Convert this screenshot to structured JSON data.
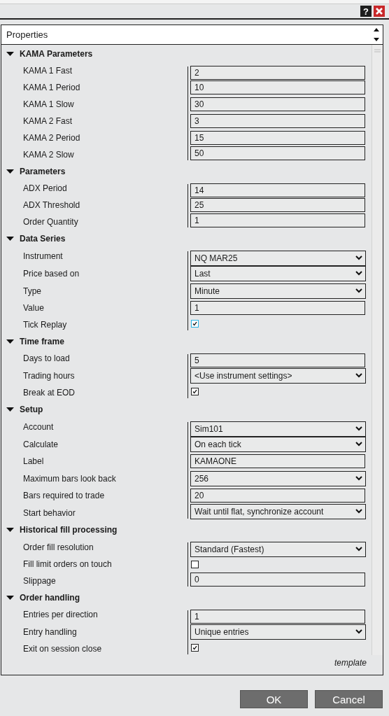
{
  "title_bar": {
    "help_label": "?"
  },
  "properties_header": {
    "title": "Properties"
  },
  "sections": [
    {
      "name": "KAMA Parameters",
      "expanded": true,
      "rows": [
        {
          "label": "KAMA 1 Fast",
          "kind": "text",
          "value": "2"
        },
        {
          "label": "KAMA 1 Period",
          "kind": "text",
          "value": "10"
        },
        {
          "label": "KAMA 1 Slow",
          "kind": "text",
          "value": "30"
        },
        {
          "label": "KAMA 2 Fast",
          "kind": "text",
          "value": "3"
        },
        {
          "label": "KAMA 2 Period",
          "kind": "text",
          "value": "15"
        },
        {
          "label": "KAMA 2 Slow",
          "kind": "text",
          "value": "50"
        }
      ]
    },
    {
      "name": "Parameters",
      "expanded": true,
      "rows": [
        {
          "label": "ADX Period",
          "kind": "text",
          "value": "14"
        },
        {
          "label": "ADX Threshold",
          "kind": "text",
          "value": "25"
        },
        {
          "label": "Order Quantity",
          "kind": "text",
          "value": "1"
        }
      ]
    },
    {
      "name": "Data Series",
      "expanded": true,
      "rows": [
        {
          "label": "Instrument",
          "kind": "dropdown",
          "value": "NQ MAR25"
        },
        {
          "label": "Price based on",
          "kind": "dropdown",
          "value": "Last"
        },
        {
          "label": "Type",
          "kind": "dropdown",
          "value": "Minute"
        },
        {
          "label": "Value",
          "kind": "text",
          "value": "1"
        },
        {
          "label": "Tick Replay",
          "kind": "checkbox",
          "checked": true,
          "focused": true
        }
      ]
    },
    {
      "name": "Time frame",
      "expanded": true,
      "rows": [
        {
          "label": "Days to load",
          "kind": "text",
          "value": "5"
        },
        {
          "label": "Trading hours",
          "kind": "dropdown",
          "value": "<Use instrument settings>"
        },
        {
          "label": "Break at EOD",
          "kind": "checkbox",
          "checked": true,
          "focused": false
        }
      ]
    },
    {
      "name": "Setup",
      "expanded": true,
      "rows": [
        {
          "label": "Account",
          "kind": "dropdown",
          "value": "Sim101"
        },
        {
          "label": "Calculate",
          "kind": "dropdown",
          "value": "On each tick"
        },
        {
          "label": "Label",
          "kind": "text",
          "value": "KAMAONE"
        },
        {
          "label": "Maximum bars look back",
          "kind": "dropdown",
          "value": "256"
        },
        {
          "label": "Bars required to trade",
          "kind": "text",
          "value": "20"
        },
        {
          "label": "Start behavior",
          "kind": "dropdown",
          "value": "Wait until flat, synchronize account"
        }
      ]
    },
    {
      "name": "Historical fill processing",
      "expanded": true,
      "rows": [
        {
          "label": "Order fill resolution",
          "kind": "dropdown",
          "value": "Standard (Fastest)"
        },
        {
          "label": "Fill limit orders on touch",
          "kind": "checkbox",
          "checked": false,
          "focused": false
        },
        {
          "label": "Slippage",
          "kind": "text",
          "value": "0"
        }
      ]
    },
    {
      "name": "Order handling",
      "expanded": true,
      "rows": [
        {
          "label": "Entries per direction",
          "kind": "text",
          "value": "1"
        },
        {
          "label": "Entry handling",
          "kind": "dropdown",
          "value": "Unique entries"
        },
        {
          "label": "Exit on session close",
          "kind": "checkbox",
          "checked": true,
          "focused": false
        }
      ]
    }
  ],
  "template_link": "template",
  "buttons": [
    "OK",
    "Cancel"
  ]
}
